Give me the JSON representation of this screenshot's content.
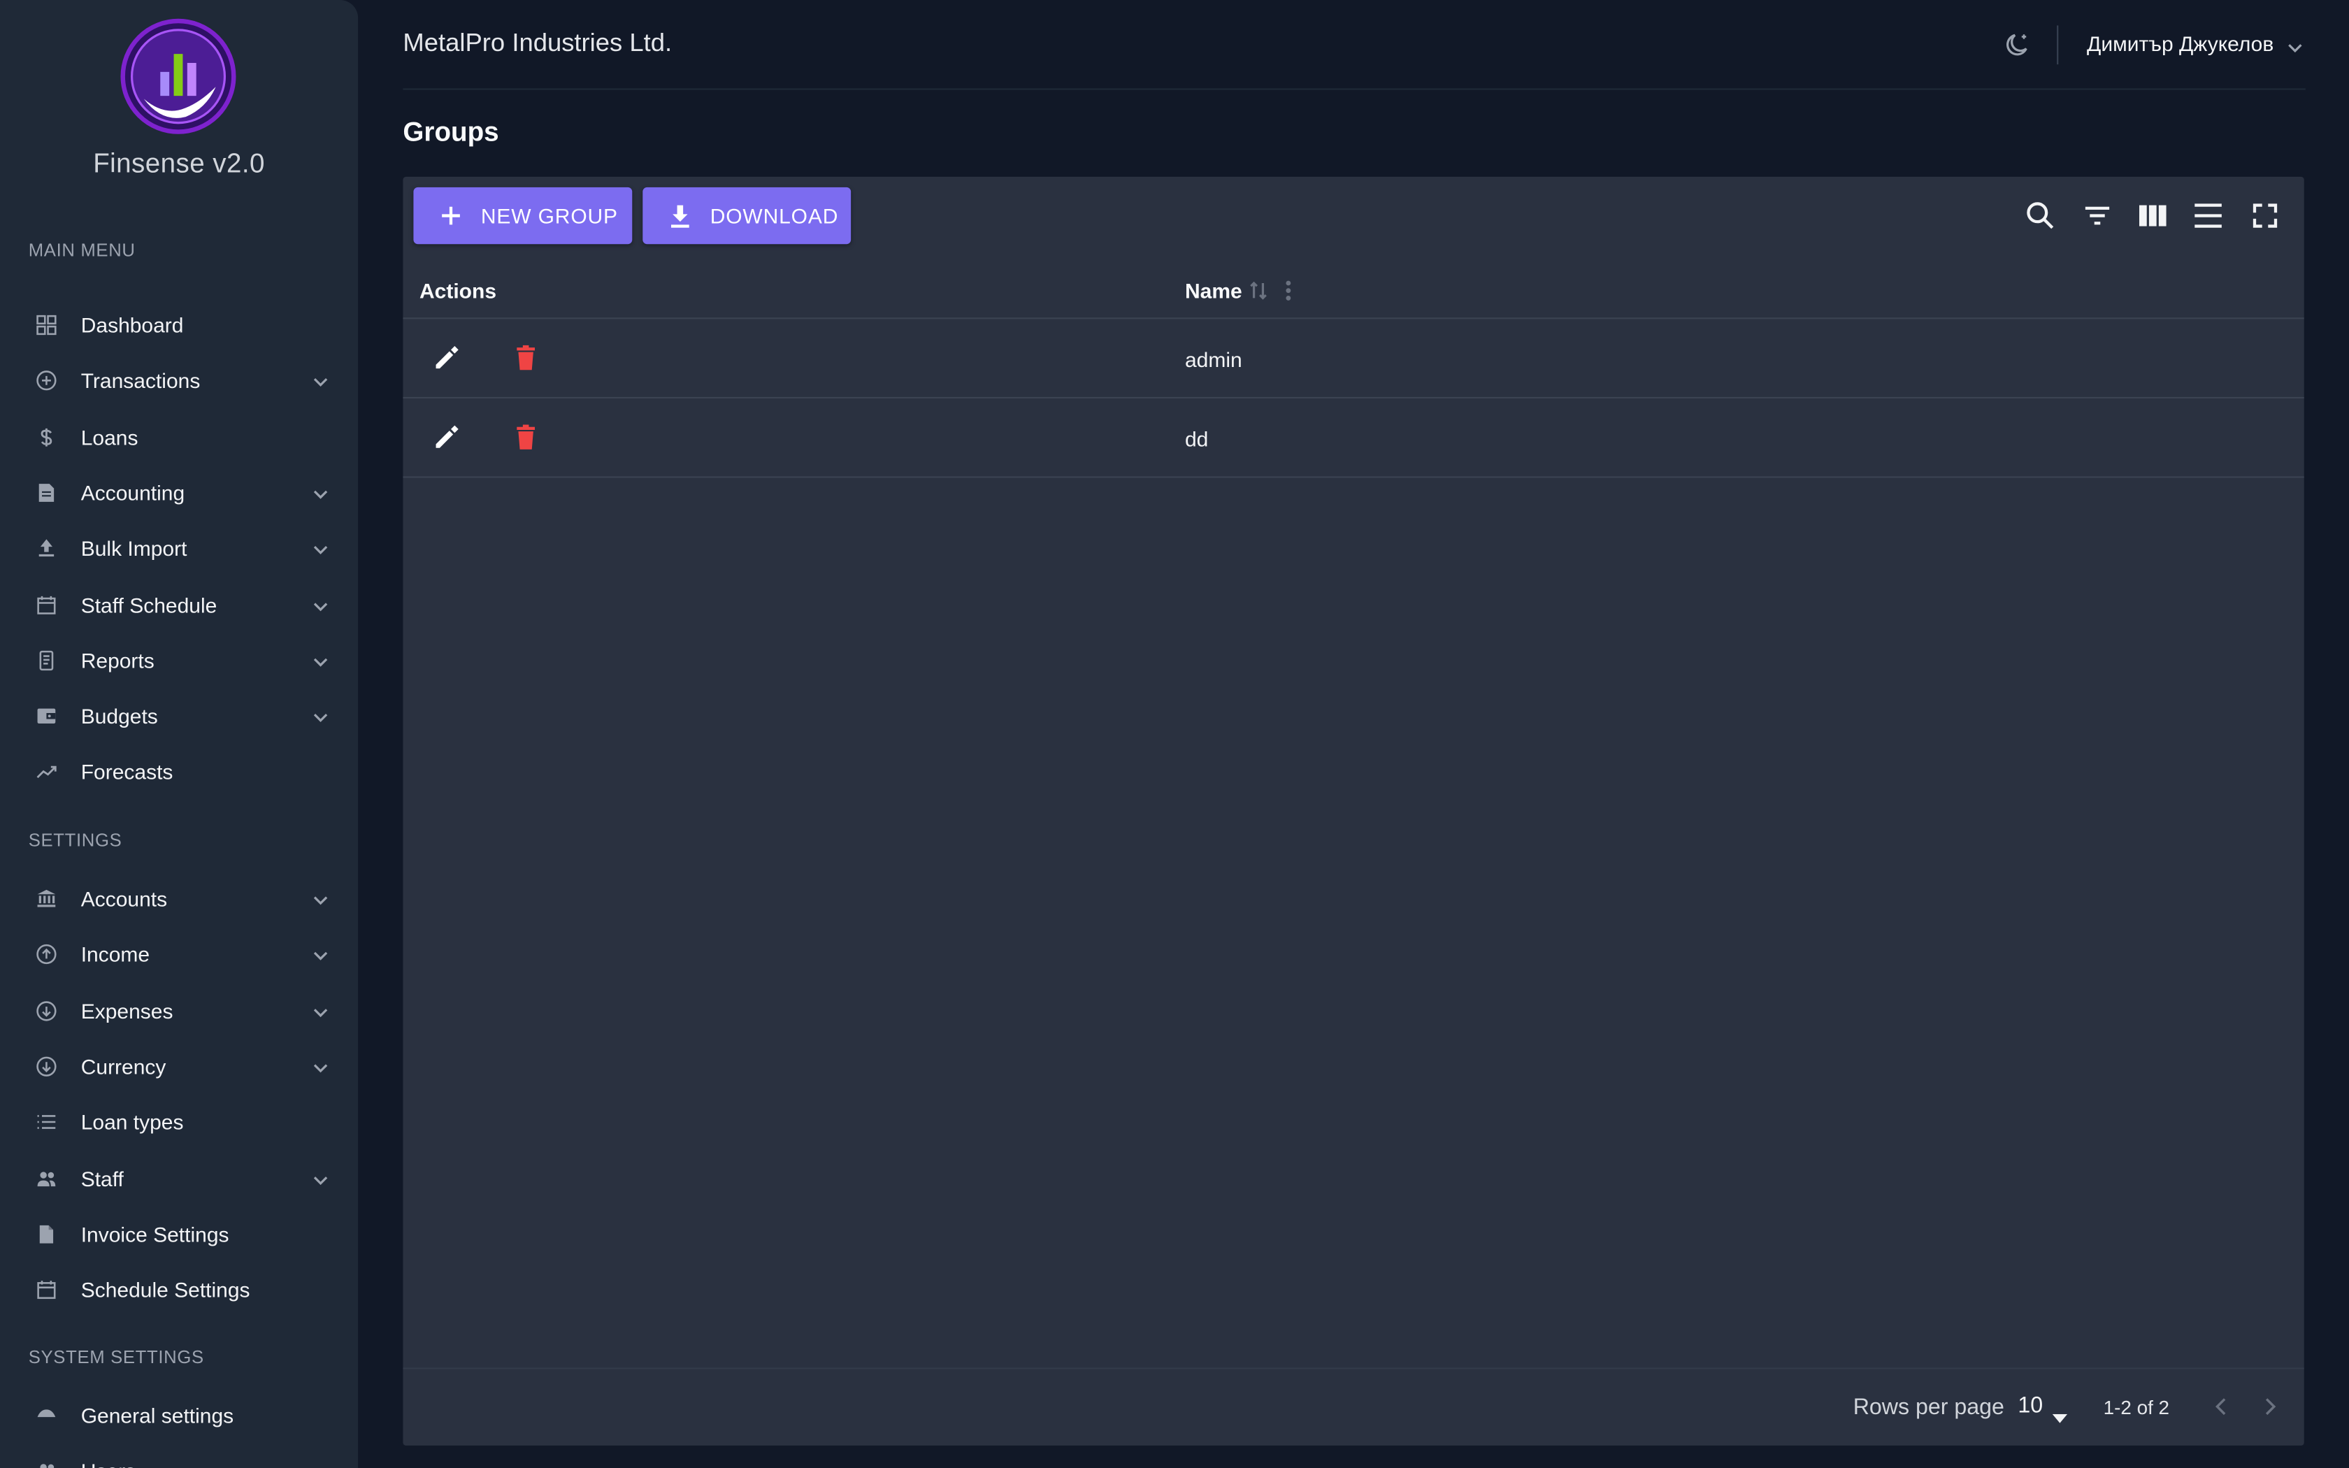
{
  "app": {
    "brand": "Finsense v2.0"
  },
  "sidebar": {
    "main_menu_label": "MAIN MENU",
    "settings_label": "SETTINGS",
    "system_settings_label": "SYSTEM SETTINGS",
    "main_items": [
      {
        "label": "Dashboard",
        "icon": "grid-icon",
        "expandable": false
      },
      {
        "label": "Transactions",
        "icon": "plus-circle-icon",
        "expandable": true
      },
      {
        "label": "Loans",
        "icon": "dollar-icon",
        "expandable": false
      },
      {
        "label": "Accounting",
        "icon": "document-icon",
        "expandable": true
      },
      {
        "label": "Bulk Import",
        "icon": "upload-icon",
        "expandable": true
      },
      {
        "label": "Staff Schedule",
        "icon": "calendar-icon",
        "expandable": true
      },
      {
        "label": "Reports",
        "icon": "report-icon",
        "expandable": true
      },
      {
        "label": "Budgets",
        "icon": "wallet-icon",
        "expandable": true
      },
      {
        "label": "Forecasts",
        "icon": "trending-up-icon",
        "expandable": false
      }
    ],
    "settings_items": [
      {
        "label": "Accounts",
        "icon": "bank-icon",
        "expandable": true
      },
      {
        "label": "Income",
        "icon": "arrow-up-circle-icon",
        "expandable": true
      },
      {
        "label": "Expenses",
        "icon": "arrow-down-circle-icon",
        "expandable": true
      },
      {
        "label": "Currency",
        "icon": "arrow-down-circle-icon",
        "expandable": true
      },
      {
        "label": "Loan types",
        "icon": "list-icon",
        "expandable": false
      },
      {
        "label": "Staff",
        "icon": "people-icon",
        "expandable": true
      },
      {
        "label": "Invoice Settings",
        "icon": "file-icon",
        "expandable": false
      },
      {
        "label": "Schedule Settings",
        "icon": "calendar-icon",
        "expandable": false
      }
    ],
    "system_items": [
      {
        "label": "General settings",
        "icon": "cloud-icon",
        "expandable": false
      },
      {
        "label": "Users",
        "icon": "people-icon",
        "expandable": false
      }
    ]
  },
  "header": {
    "company": "MetalPro Industries Ltd.",
    "theme_icon": "moon-icon",
    "user_name": "Димитър Джукелов"
  },
  "page": {
    "title": "Groups"
  },
  "toolbar": {
    "new_group_label": "NEW GROUP",
    "download_label": "DOWNLOAD"
  },
  "table": {
    "columns": {
      "actions": "Actions",
      "name": "Name"
    },
    "rows": [
      {
        "name": "admin"
      },
      {
        "name": "dd"
      }
    ]
  },
  "pagination": {
    "rows_per_page_label": "Rows per page",
    "rows_per_page_value": "10",
    "range_label": "1-2 of 2"
  },
  "colors": {
    "accent": "#7c6cf0",
    "delete": "#ef4444",
    "background": "#111827",
    "sidebar": "#1f2937",
    "card": "#2a3140"
  }
}
